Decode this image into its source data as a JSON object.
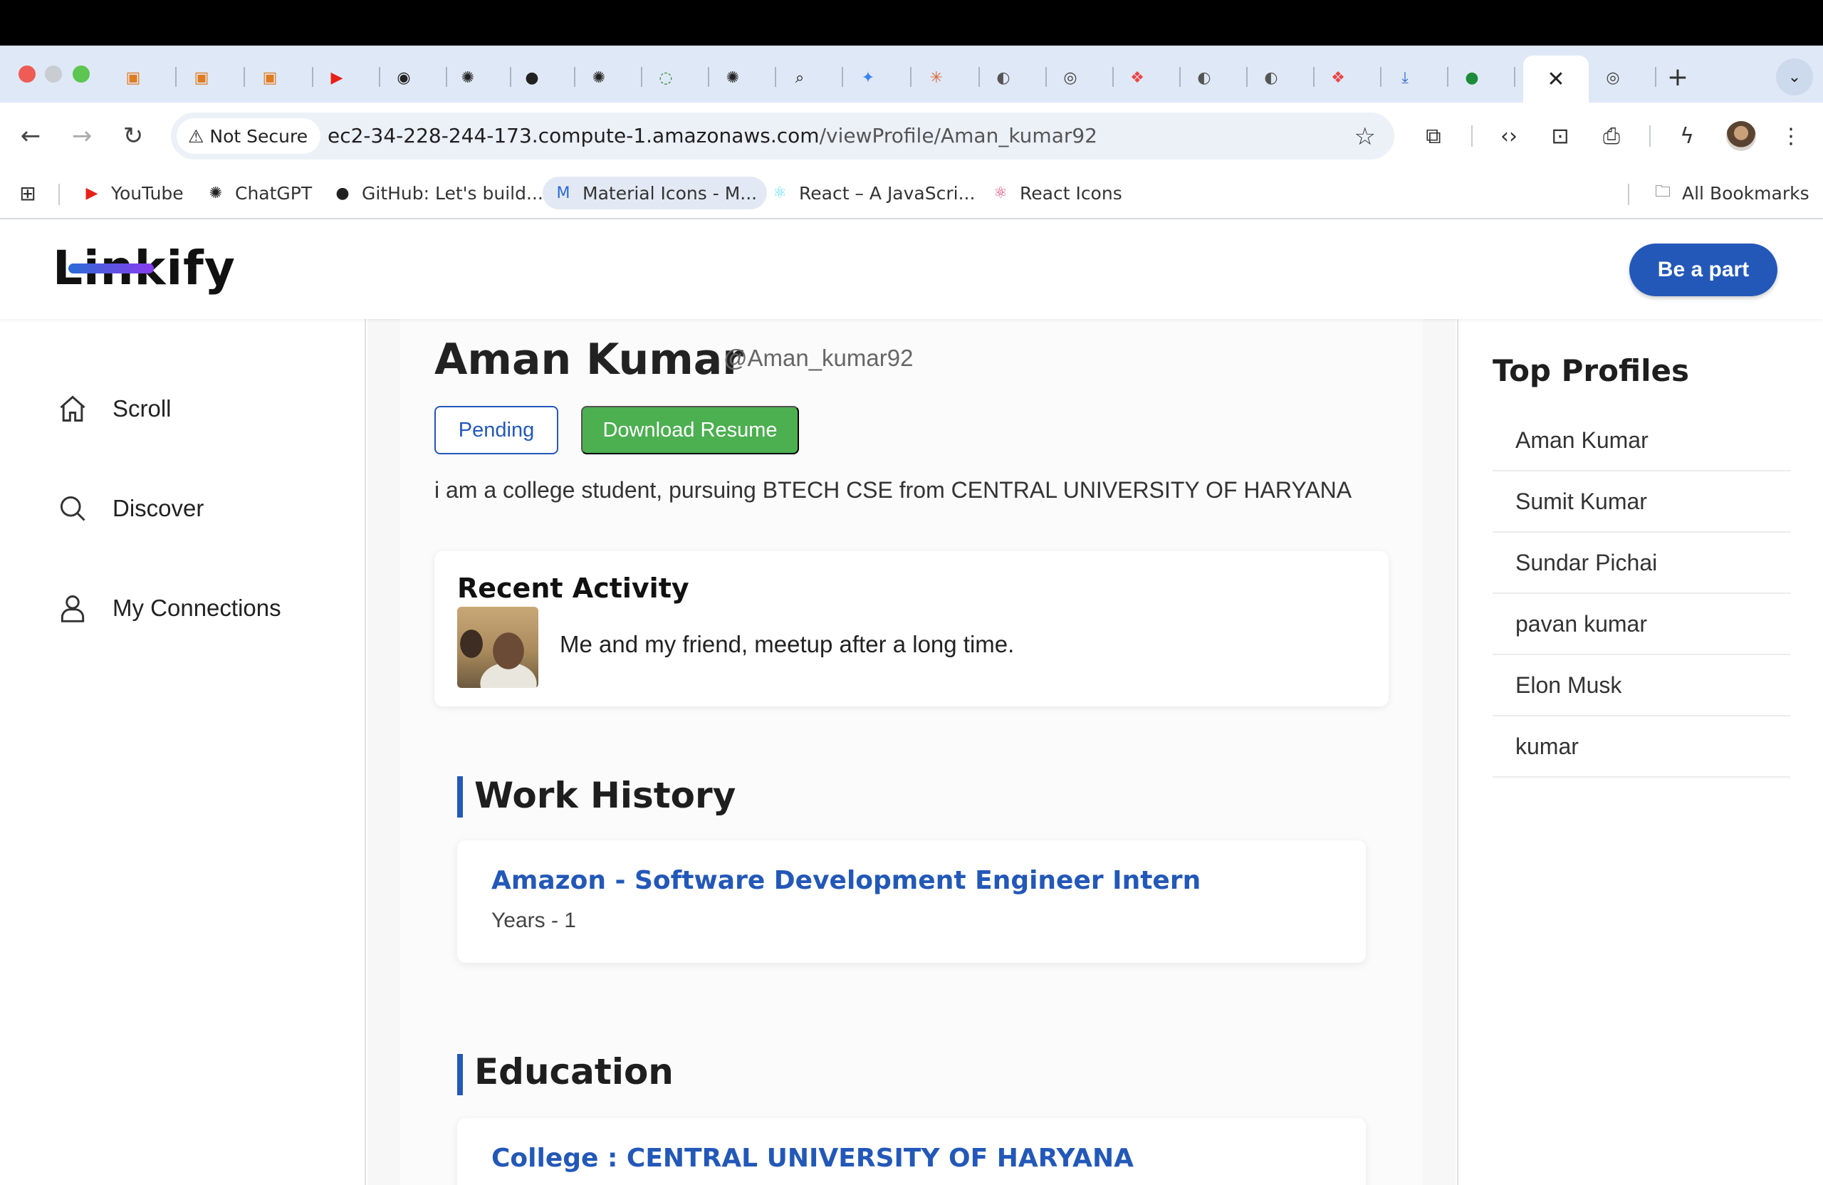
{
  "browser": {
    "tabs": [
      {
        "icon": "aws-icon",
        "glyph": "▣",
        "color": "#e07b1f"
      },
      {
        "icon": "aws-icon",
        "glyph": "▣",
        "color": "#e07b1f"
      },
      {
        "icon": "aws-icon",
        "glyph": "▣",
        "color": "#e07b1f"
      },
      {
        "icon": "youtube-icon",
        "glyph": "▶",
        "color": "#e62117"
      },
      {
        "icon": "copilot-icon",
        "glyph": "◉",
        "color": "#222"
      },
      {
        "icon": "chatgpt-icon",
        "glyph": "✺",
        "color": "#222"
      },
      {
        "icon": "github-icon",
        "glyph": "●",
        "color": "#222"
      },
      {
        "icon": "chatgpt-icon",
        "glyph": "✺",
        "color": "#222"
      },
      {
        "icon": "spinner-icon",
        "glyph": "◌",
        "color": "#2a8c3a"
      },
      {
        "icon": "chatgpt-icon",
        "glyph": "✺",
        "color": "#222"
      },
      {
        "icon": "search-dark-icon",
        "glyph": "⌕",
        "color": "#111"
      },
      {
        "icon": "gemini-icon",
        "glyph": "✦",
        "color": "#3b82f6"
      },
      {
        "icon": "claude-icon",
        "glyph": "✳",
        "color": "#d9693e"
      },
      {
        "icon": "globe-icon",
        "glyph": "◐",
        "color": "#555"
      },
      {
        "icon": "chrome-icon",
        "glyph": "◎",
        "color": "#444"
      },
      {
        "icon": "figma-icon",
        "glyph": "❖",
        "color": "#e44"
      },
      {
        "icon": "globe-icon",
        "glyph": "◐",
        "color": "#555"
      },
      {
        "icon": "globe-icon",
        "glyph": "◐",
        "color": "#555"
      },
      {
        "icon": "figma-icon",
        "glyph": "❖",
        "color": "#e44"
      },
      {
        "icon": "download-icon",
        "glyph": "⤓",
        "color": "#2b6bd6"
      },
      {
        "icon": "mongodb-icon",
        "glyph": "●",
        "color": "#1c8c3a"
      }
    ],
    "active_tab_close": "✕",
    "extra_tab_glyph": "◎",
    "new_tab": "+",
    "tab_menu": "⌄",
    "security_label": "Not Secure",
    "url_host": "ec2-34-228-244-173.compute-1.amazonaws.com",
    "url_path": "/viewProfile/Aman_kumar92",
    "bookmarks": [
      {
        "label": "YouTube",
        "icon": "youtube-icon",
        "glyph": "▶",
        "color": "#e62117"
      },
      {
        "label": "ChatGPT",
        "icon": "chatgpt-icon",
        "glyph": "✺",
        "color": "#222"
      },
      {
        "label": "GitHub: Let's build...",
        "icon": "github-icon",
        "glyph": "●",
        "color": "#222"
      },
      {
        "label": "Material Icons - M...",
        "icon": "material-icons-icon",
        "glyph": "M",
        "color": "#2b6bd6"
      },
      {
        "label": "React – A JavaScri...",
        "icon": "react-icon",
        "glyph": "⚛",
        "color": "#61dafb"
      },
      {
        "label": "React Icons",
        "icon": "react-icons-icon",
        "glyph": "⚛",
        "color": "#e0457b"
      }
    ],
    "all_bookmarks": "All Bookmarks"
  },
  "header": {
    "logo": "Linkify",
    "cta": "Be a part"
  },
  "sidebar": {
    "items": [
      {
        "label": "Scroll",
        "icon": "home-icon"
      },
      {
        "label": "Discover",
        "icon": "search-icon"
      },
      {
        "label": "My Connections",
        "icon": "user-icon"
      }
    ]
  },
  "profile": {
    "name": "Aman Kumar",
    "username": "@Aman_kumar92",
    "pending_label": "Pending",
    "resume_label": "Download Resume",
    "bio": "i am a college student, pursuing BTECH CSE from CENTRAL UNIVERSITY OF HARYANA"
  },
  "activity": {
    "title": "Recent Activity",
    "post_text": "Me and my friend, meetup after a long time."
  },
  "work": {
    "title": "Work History",
    "items": [
      {
        "title": "Amazon - Software Development Engineer Intern",
        "years": "Years - 1"
      }
    ]
  },
  "education": {
    "title": "Education",
    "items": [
      {
        "title": "College : CENTRAL UNIVERSITY OF HARYANA"
      }
    ]
  },
  "top_profiles": {
    "title": "Top Profiles",
    "items": [
      "Aman Kumar",
      "Sumit Kumar",
      "Sundar Pichai",
      "pavan kumar",
      "Elon Musk",
      "kumar"
    ]
  },
  "colors": {
    "brand_blue": "#2358b8",
    "resume_green": "#4caf50"
  }
}
